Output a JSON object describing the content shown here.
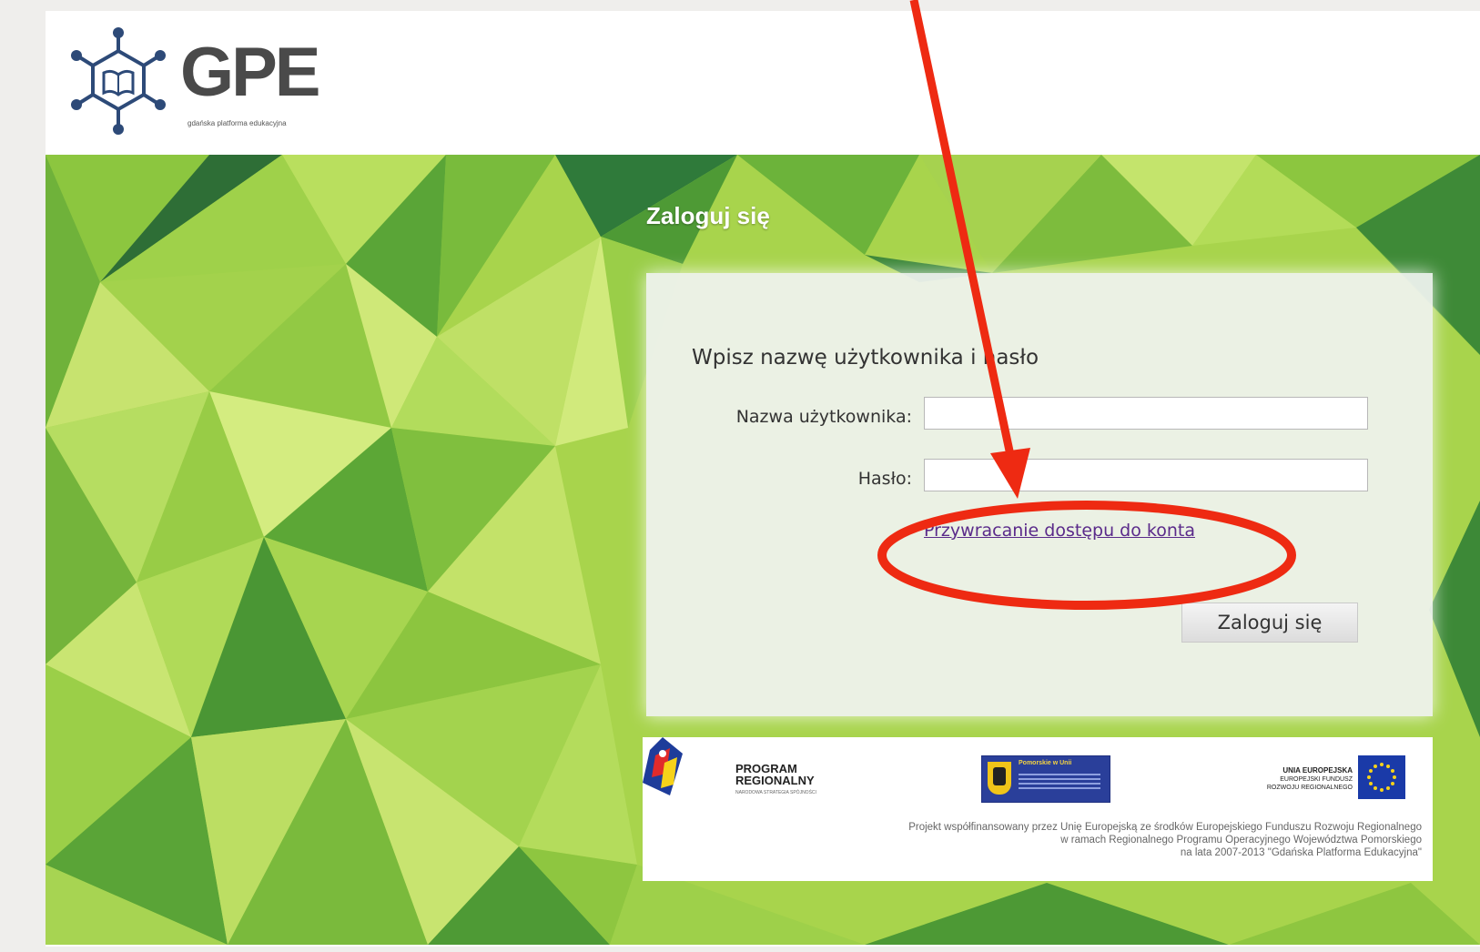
{
  "logo": {
    "text": "GPE",
    "subtitle": "gdańska platforma edukacyjna"
  },
  "hero": {
    "title": "Zaloguj się"
  },
  "login": {
    "heading": "Wpisz nazwę użytkownika i hasło",
    "username_label": "Nazwa użytkownika:",
    "username_value": "",
    "password_label": "Hasło:",
    "password_value": "",
    "recover_link": "Przywracanie dostępu do konta",
    "submit_label": "Zaloguj się"
  },
  "sponsors": {
    "program_regionalny_line1": "PROGRAM",
    "program_regionalny_line2": "REGIONALNY",
    "program_regionalny_sub": "NARODOWA STRATEGIA SPÓJNOŚCI",
    "pomorskie_title": "Pomorskie w Unii",
    "ue_line1": "UNIA EUROPEJSKA",
    "ue_line2": "EUROPEJSKI FUNDUSZ",
    "ue_line3": "ROZWOJU REGIONALNEGO",
    "note_line1": "Projekt współfinansowany przez Unię Europejską ze środków Europejskiego Funduszu Rozwoju Regionalnego",
    "note_line2": "w ramach Regionalnego Programu Operacyjnego Województwa Pomorskiego",
    "note_line3": "na lata 2007-2013 \"Gdańska Platforma Edukacyjna\""
  },
  "colors": {
    "annotation": "#ee2a12",
    "link": "#5a2a8a",
    "green_light": "#b8dc5a",
    "green_dark": "#2f7a3a"
  }
}
